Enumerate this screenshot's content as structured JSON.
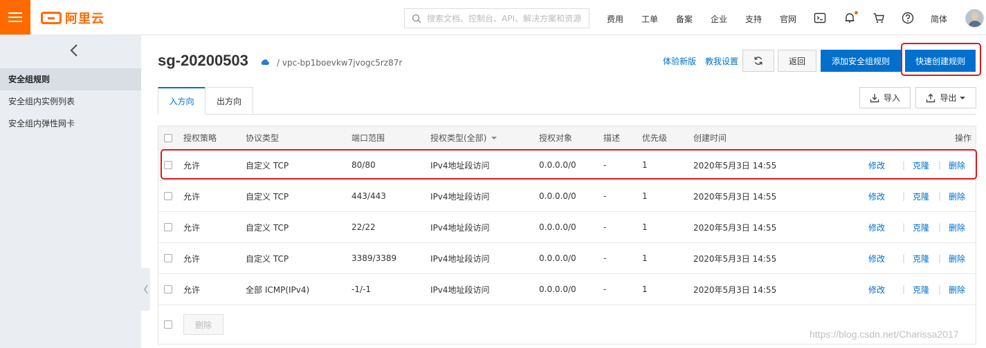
{
  "brand": {
    "name": "阿里云",
    "accent": "#ff6a00"
  },
  "search": {
    "placeholder": "搜索文档、控制台、API、解决方案和资源"
  },
  "topnav": {
    "fees": "费用",
    "tickets": "工单",
    "filing": "备案",
    "enterprise": "企业",
    "support": "支持",
    "official": "官网",
    "lang": "简体"
  },
  "sidebar": {
    "items": [
      {
        "label": "安全组规则"
      },
      {
        "label": "安全组内实例列表"
      },
      {
        "label": "安全组内弹性网卡"
      }
    ]
  },
  "header": {
    "title": "sg-20200503",
    "vpc_path": "/ vpc-bp1boevkw7jvogc5rz87r",
    "try_new": "体验新版",
    "tutorial": "教我设置",
    "back": "返回",
    "add_rule": "添加安全组规则",
    "quick_create": "快速创建规则"
  },
  "tabs": {
    "inbound": "入方向",
    "outbound": "出方向",
    "import": "导入",
    "export": "导出"
  },
  "table": {
    "columns": {
      "policy": "授权策略",
      "protocol": "协议类型",
      "port": "端口范围",
      "auth_type": "授权类型(全部)",
      "auth_object": "授权对象",
      "description": "描述",
      "priority": "优先级",
      "created": "创建时间",
      "actions": "操作"
    },
    "rows": [
      {
        "policy": "允许",
        "protocol": "自定义 TCP",
        "port": "80/80",
        "auth_type": "IPv4地址段访问",
        "auth_object": "0.0.0.0/0",
        "description": "-",
        "priority": "1",
        "created": "2020年5月3日 14:55"
      },
      {
        "policy": "允许",
        "protocol": "自定义 TCP",
        "port": "443/443",
        "auth_type": "IPv4地址段访问",
        "auth_object": "0.0.0.0/0",
        "description": "-",
        "priority": "1",
        "created": "2020年5月3日 14:55"
      },
      {
        "policy": "允许",
        "protocol": "自定义 TCP",
        "port": "22/22",
        "auth_type": "IPv4地址段访问",
        "auth_object": "0.0.0.0/0",
        "description": "-",
        "priority": "1",
        "created": "2020年5月3日 14:55"
      },
      {
        "policy": "允许",
        "protocol": "自定义 TCP",
        "port": "3389/3389",
        "auth_type": "IPv4地址段访问",
        "auth_object": "0.0.0.0/0",
        "description": "-",
        "priority": "1",
        "created": "2020年5月3日 14:55"
      },
      {
        "policy": "允许",
        "protocol": "全部 ICMP(IPv4)",
        "port": "-1/-1",
        "auth_type": "IPv4地址段访问",
        "auth_object": "0.0.0.0/0",
        "description": "-",
        "priority": "1",
        "created": "2020年5月3日 14:55"
      }
    ],
    "actions": {
      "edit": "修改",
      "clone": "克隆",
      "delete": "删除"
    },
    "bulk_delete": "删除"
  },
  "watermark": "https://blog.csdn.net/Charissa2017",
  "colors": {
    "link": "#0070cc",
    "highlight": "#e0171d"
  }
}
